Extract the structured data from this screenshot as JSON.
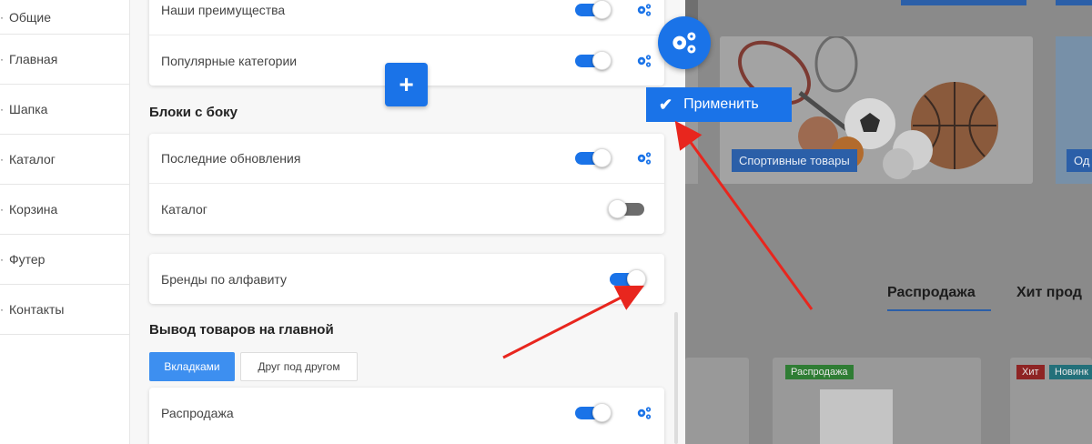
{
  "sidebar": {
    "items": [
      {
        "label": "Общие"
      },
      {
        "label": "Главная"
      },
      {
        "label": "Шапка"
      },
      {
        "label": "Каталог"
      },
      {
        "label": "Корзина"
      },
      {
        "label": "Футер"
      },
      {
        "label": "Контакты"
      }
    ]
  },
  "panel": {
    "main_blocks": [
      {
        "label": "Наши преимущества",
        "enabled": true
      },
      {
        "label": "Популярные категории",
        "enabled": true
      }
    ],
    "side_section_title": "Блоки с боку",
    "side_blocks": [
      {
        "label": "Последние обновления",
        "enabled": true
      },
      {
        "label": "Каталог",
        "enabled": false
      }
    ],
    "brands_block": {
      "label": "Бренды по алфавиту",
      "enabled": true
    },
    "products_section_title": "Вывод товаров на главной",
    "display_modes": [
      {
        "label": "Вкладками",
        "active": true
      },
      {
        "label": "Друг под другом",
        "active": false
      }
    ],
    "product_blocks": [
      {
        "label": "Распродажа",
        "enabled": true
      }
    ],
    "add_button": "+"
  },
  "toolbar": {
    "apply_label": "Применить"
  },
  "site": {
    "category_label": "Спортивные товары",
    "category_label_2": "Од",
    "tab_sale": "Распродажа",
    "tab_hits": "Хит прод",
    "badge_sale": "Распродажа",
    "badge_hit": "Хит",
    "badge_new": "Новинк"
  },
  "colors": {
    "accent": "#1a73e8",
    "toggle_off": "#6d6d6d",
    "arrow": "#e8261e"
  }
}
